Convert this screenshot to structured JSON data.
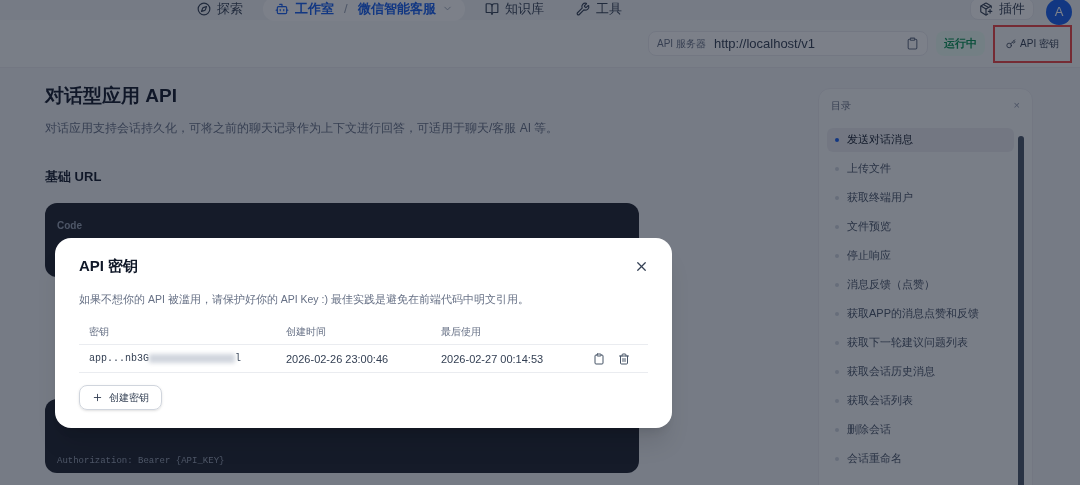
{
  "nav": {
    "items": [
      {
        "label": "探索",
        "selected": false
      },
      {
        "label": "工作室",
        "selected": true,
        "separator": "/",
        "breadcrumb": "微信智能客服"
      },
      {
        "label": "知识库",
        "selected": false
      },
      {
        "label": "工具",
        "selected": false
      }
    ],
    "plugins": "插件",
    "avatar": "A"
  },
  "server_bar": {
    "label": "API 服务器",
    "url": "http://localhost/v1",
    "status": "运行中",
    "api_key_button": "API 密钥",
    "highlighted": true
  },
  "doc": {
    "title": "对话型应用 API",
    "description": "对话应用支持会话持久化，可将之前的聊天记录作为上下文进行回答，可适用于聊天/客服 AI 等。",
    "base_url_heading": "基础 URL",
    "code_label": "Code",
    "auth_code": "Authorization: Bearer {API_KEY}"
  },
  "toc": {
    "title": "目录",
    "close": "×",
    "items": [
      {
        "label": "发送对话消息",
        "selected": true
      },
      {
        "label": "上传文件",
        "selected": false
      },
      {
        "label": "获取终端用户",
        "selected": false
      },
      {
        "label": "文件预览",
        "selected": false
      },
      {
        "label": "停止响应",
        "selected": false
      },
      {
        "label": "消息反馈（点赞）",
        "selected": false
      },
      {
        "label": "获取APP的消息点赞和反馈",
        "selected": false
      },
      {
        "label": "获取下一轮建议问题列表",
        "selected": false
      },
      {
        "label": "获取会话历史消息",
        "selected": false
      },
      {
        "label": "获取会话列表",
        "selected": false
      },
      {
        "label": "删除会话",
        "selected": false
      },
      {
        "label": "会话重命名",
        "selected": false
      }
    ]
  },
  "modal": {
    "title": "API 密钥",
    "description": "如果不想你的 API 被滥用，请保护好你的 API Key :) 最佳实践是避免在前端代码中明文引用。",
    "columns": [
      "密钥",
      "创建时间",
      "最后使用"
    ],
    "rows": [
      {
        "key_prefix": "app...nb3G",
        "key_suffix": "l",
        "created": "2026-02-26 23:00:46",
        "last_used": "2026-02-27 00:14:53"
      }
    ],
    "create_button": "创建密钥"
  }
}
